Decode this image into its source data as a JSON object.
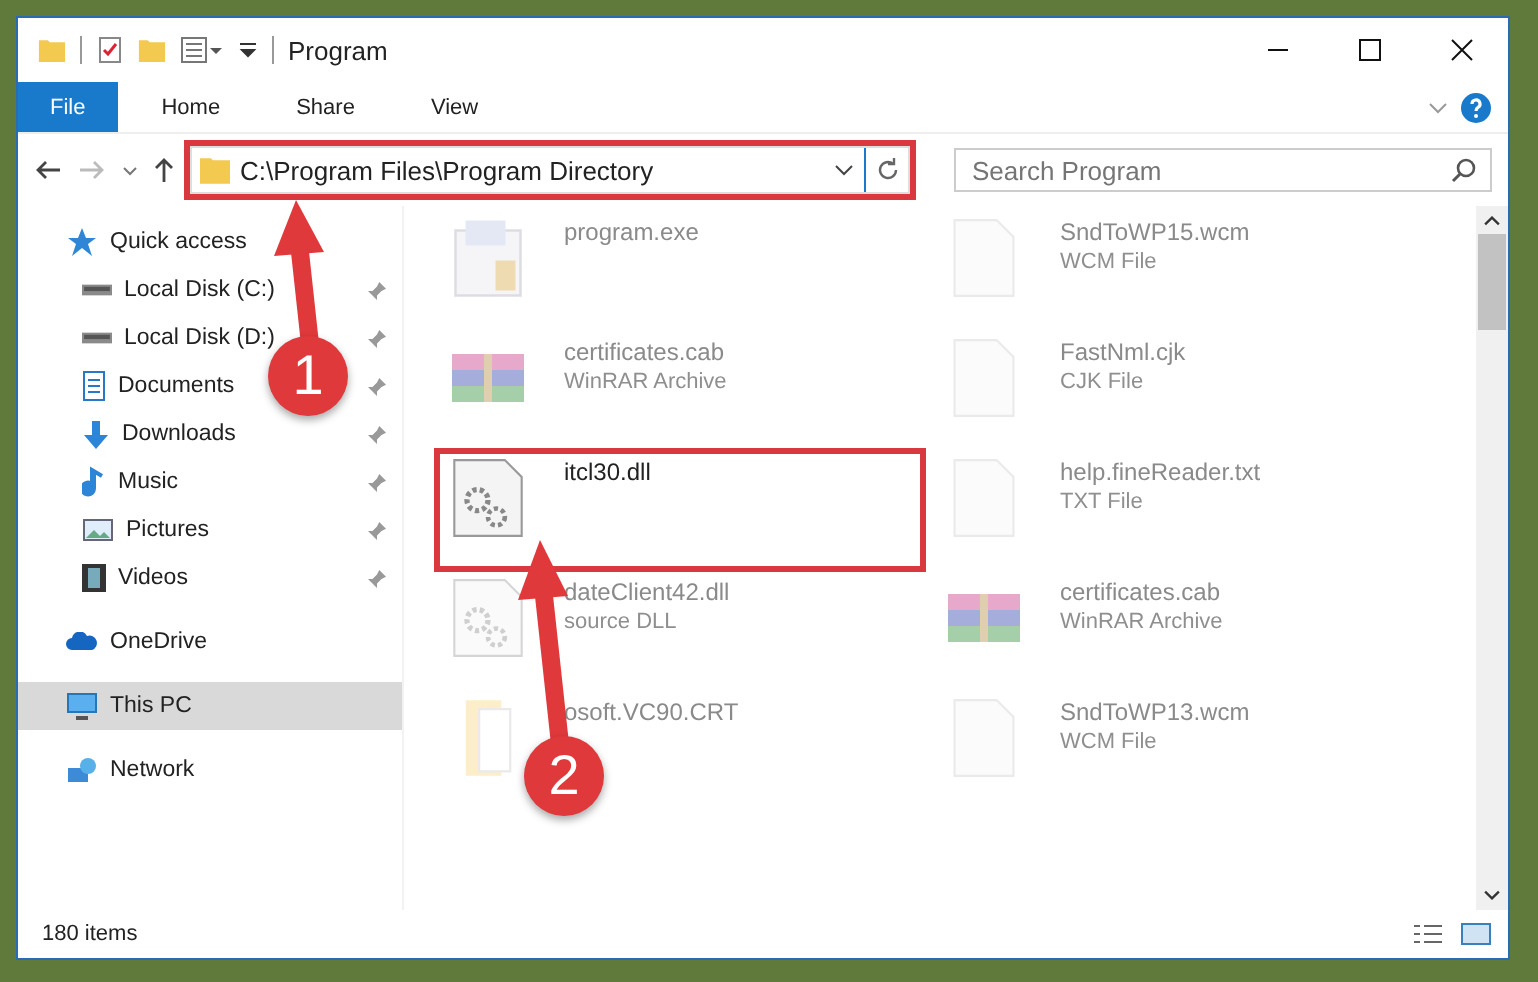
{
  "window": {
    "title": "Program"
  },
  "ribbon_tabs": [
    {
      "label": "File",
      "selected": true
    },
    {
      "label": "Home",
      "selected": false
    },
    {
      "label": "Share",
      "selected": false
    },
    {
      "label": "View",
      "selected": false
    }
  ],
  "address_bar": {
    "path": "C:\\Program Files\\Program Directory",
    "highlighted": true
  },
  "search": {
    "placeholder": "Search Program"
  },
  "sidebar": {
    "items": [
      {
        "label": "Quick access",
        "kind": "star",
        "selected": false,
        "children": [
          {
            "label": "Local Disk (C:)",
            "kind": "disk",
            "selected": false
          },
          {
            "label": "Local Disk (D:)",
            "kind": "disk",
            "selected": false
          },
          {
            "label": "Documents",
            "kind": "docs",
            "selected": false
          },
          {
            "label": "Downloads",
            "kind": "download",
            "selected": false
          },
          {
            "label": "Music",
            "kind": "music",
            "selected": false
          },
          {
            "label": "Pictures",
            "kind": "pictures",
            "selected": false
          },
          {
            "label": "Videos",
            "kind": "videos",
            "selected": false
          }
        ]
      },
      {
        "label": "OneDrive",
        "kind": "cloud",
        "selected": false
      },
      {
        "label": "This PC",
        "kind": "pc",
        "selected": true
      },
      {
        "label": "Network",
        "kind": "network",
        "selected": false
      }
    ]
  },
  "files": [
    {
      "name": "program.exe",
      "kind": "exe",
      "highlighted": false
    },
    {
      "name": "SndToWP15.wcm",
      "type": "WCM File",
      "kind": "blank",
      "highlighted": false
    },
    {
      "name": "certificates.cab",
      "type": "WinRAR Archive",
      "kind": "archive",
      "highlighted": false
    },
    {
      "name": "FastNml.cjk",
      "type": "CJK File",
      "kind": "blank",
      "highlighted": false
    },
    {
      "name": "itcl30.dll",
      "kind": "dll",
      "highlighted": true
    },
    {
      "name": "help.fineReader.txt",
      "type": "TXT File",
      "kind": "blank",
      "highlighted": false
    },
    {
      "name": "dateClient42.dll",
      "type": "source DLL",
      "kind": "dll",
      "highlighted": false
    },
    {
      "name": "certificates.cab",
      "type": "WinRAR Archive",
      "kind": "archive",
      "highlighted": false
    },
    {
      "name": "osoft.VC90.CRT",
      "kind": "folder",
      "highlighted": false
    },
    {
      "name": "SndToWP13.wcm",
      "type": "WCM File",
      "kind": "blank",
      "highlighted": false
    }
  ],
  "status_bar": {
    "count": "180 items"
  },
  "annotations": [
    {
      "label": "1"
    },
    {
      "label": "2"
    }
  ]
}
